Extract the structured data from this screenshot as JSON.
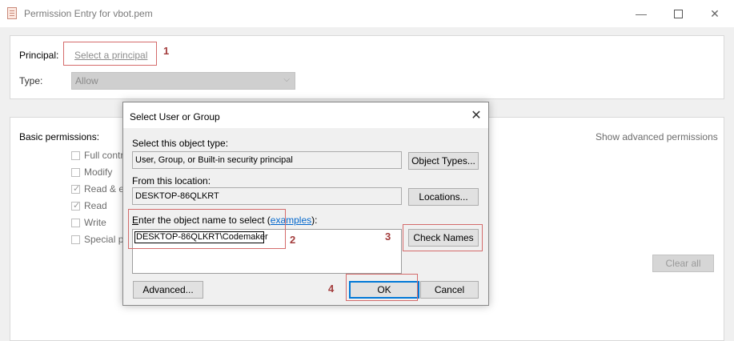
{
  "window": {
    "title": "Permission Entry for vbot.pem",
    "minimize_glyph": "—",
    "close_glyph": "✕"
  },
  "principal": {
    "label": "Principal:",
    "link_text": "Select a principal",
    "annotation": "1"
  },
  "type": {
    "label": "Type:",
    "value": "Allow"
  },
  "permissions": {
    "label": "Basic permissions:",
    "show_advanced": "Show advanced permissions",
    "items": [
      {
        "label": "Full contr",
        "checked": false
      },
      {
        "label": "Modify",
        "checked": false
      },
      {
        "label": "Read & e",
        "checked": true
      },
      {
        "label": "Read",
        "checked": true
      },
      {
        "label": "Write",
        "checked": false
      },
      {
        "label": "Special p",
        "checked": false
      }
    ],
    "clear_all": "Clear all"
  },
  "dialog": {
    "title": "Select User or Group",
    "object_type_label": "Select this object type:",
    "object_type_value": "User, Group, or Built-in security principal",
    "object_types_button": "Object Types...",
    "location_label": "From this location:",
    "location_value": "DESKTOP-86QLKRT",
    "locations_button": "Locations...",
    "name_label_accel": "E",
    "name_label_rest": "nter the object name to select (",
    "name_label_link": "examples",
    "name_label_end": "):",
    "name_value": "DESKTOP-86QLKRT\\Codemaker",
    "check_names_button": "Check Names",
    "advanced_button": "Advanced...",
    "ok_button": "OK",
    "cancel_button": "Cancel",
    "annotation_2": "2",
    "annotation_3": "3",
    "annotation_4": "4"
  },
  "colors": {
    "annotation_red": "#a33d3d",
    "highlight_border": "#d46b6b",
    "focus_blue": "#0078d7"
  }
}
